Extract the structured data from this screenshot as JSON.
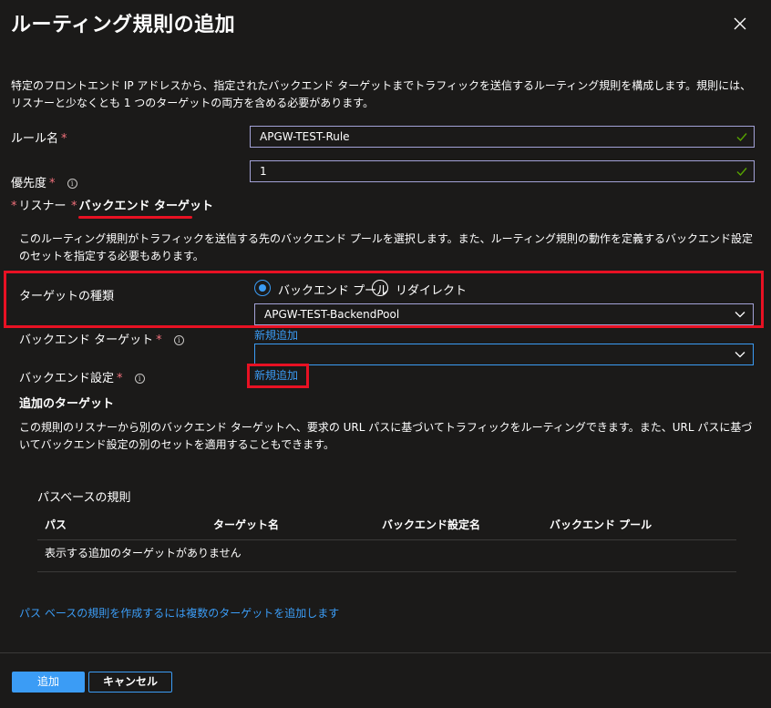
{
  "header": {
    "title": "ルーティング規則の追加"
  },
  "description": "特定のフロントエンド IP アドレスから、指定されたバックエンド ターゲットまでトラフィックを送信するルーティング規則を構成します。規則には、リスナーと少なくとも 1 つのターゲットの両方を含める必要があります。",
  "form": {
    "rule_name_label": "ルール名",
    "rule_name_value": "APGW-TEST-Rule",
    "priority_label": "優先度",
    "priority_value": "1",
    "required_mark": "*"
  },
  "tabs": {
    "listener": "リスナー",
    "backend_target": "バックエンド ターゲット"
  },
  "backend": {
    "description": "このルーティング規則がトラフィックを送信する先のバックエンド プールを選択します。また、ルーティング規則の動作を定義するバックエンド設定のセットを指定する必要もあります。",
    "target_type_label": "ターゲットの種類",
    "option_pool": "バックエンド プール",
    "option_redirect": "リダイレクト",
    "pool_value": "APGW-TEST-BackendPool",
    "backend_target_label": "バックエンド ターゲット",
    "new_link_1": "新規追加",
    "backend_setting_label": "バックエンド設定",
    "backend_setting_value": "",
    "new_link_2": "新規追加"
  },
  "additional": {
    "heading": "追加のターゲット",
    "description": "この規則のリスナーから別のバックエンド ターゲットへ、要求の URL パスに基づいてトラフィックをルーティングできます。また、URL パスに基づいてバックエンド設定の別のセットを適用することもできます。",
    "path_rules_title": "パスベースの規則",
    "columns": [
      "パス",
      "ターゲット名",
      "バックエンド設定名",
      "バックエンド プール"
    ],
    "empty_message": "表示する追加のターゲットがありません",
    "footer_link": "パス ベースの規則を作成するには複数のターゲットを追加します"
  },
  "footer": {
    "add_button": "追加",
    "cancel_button": "キャンセル"
  },
  "colors": {
    "background": "#1b1a19",
    "accent": "#3b9cf5",
    "highlight_red": "#e81123",
    "input_border": "#a3a2d7",
    "check_green": "#57a300"
  }
}
